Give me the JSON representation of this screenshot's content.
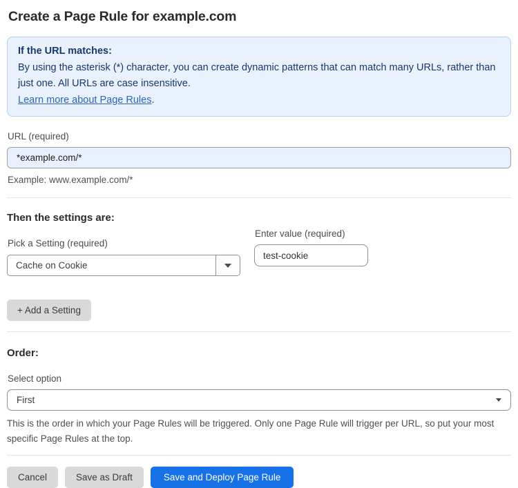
{
  "page": {
    "title": "Create a Page Rule for example.com"
  },
  "info_box": {
    "heading": "If the URL matches:",
    "body": "By using the asterisk (*) character, you can create dynamic patterns that can match many URLs, rather than just one. All URLs are case insensitive.",
    "link": "Learn more about Page Rules",
    "link_suffix": "."
  },
  "url_field": {
    "label": "URL (required)",
    "value": "*example.com/*",
    "hint": "Example: www.example.com/*"
  },
  "settings": {
    "heading": "Then the settings are:",
    "setting_label": "Pick a Setting (required)",
    "setting_value": "Cache on Cookie",
    "value_label": "Enter value (required)",
    "value_value": "test-cookie",
    "add_button": "+ Add a Setting"
  },
  "order": {
    "heading": "Order:",
    "label": "Select option",
    "value": "First",
    "description": "This is the order in which your Page Rules will be triggered. Only one Page Rule will trigger per URL, so put your most specific Page Rules at the top."
  },
  "actions": {
    "cancel": "Cancel",
    "save_draft": "Save as Draft",
    "save_deploy": "Save and Deploy Page Rule"
  },
  "colors": {
    "info_bg": "#e9f2fc",
    "info_border": "#b9d1eb",
    "info_text": "#16386b",
    "link_blue": "#2b63c1",
    "autofill_bg": "#e8f0fe",
    "primary_blue": "#1672e6",
    "button_gray": "#d9d9d9"
  }
}
